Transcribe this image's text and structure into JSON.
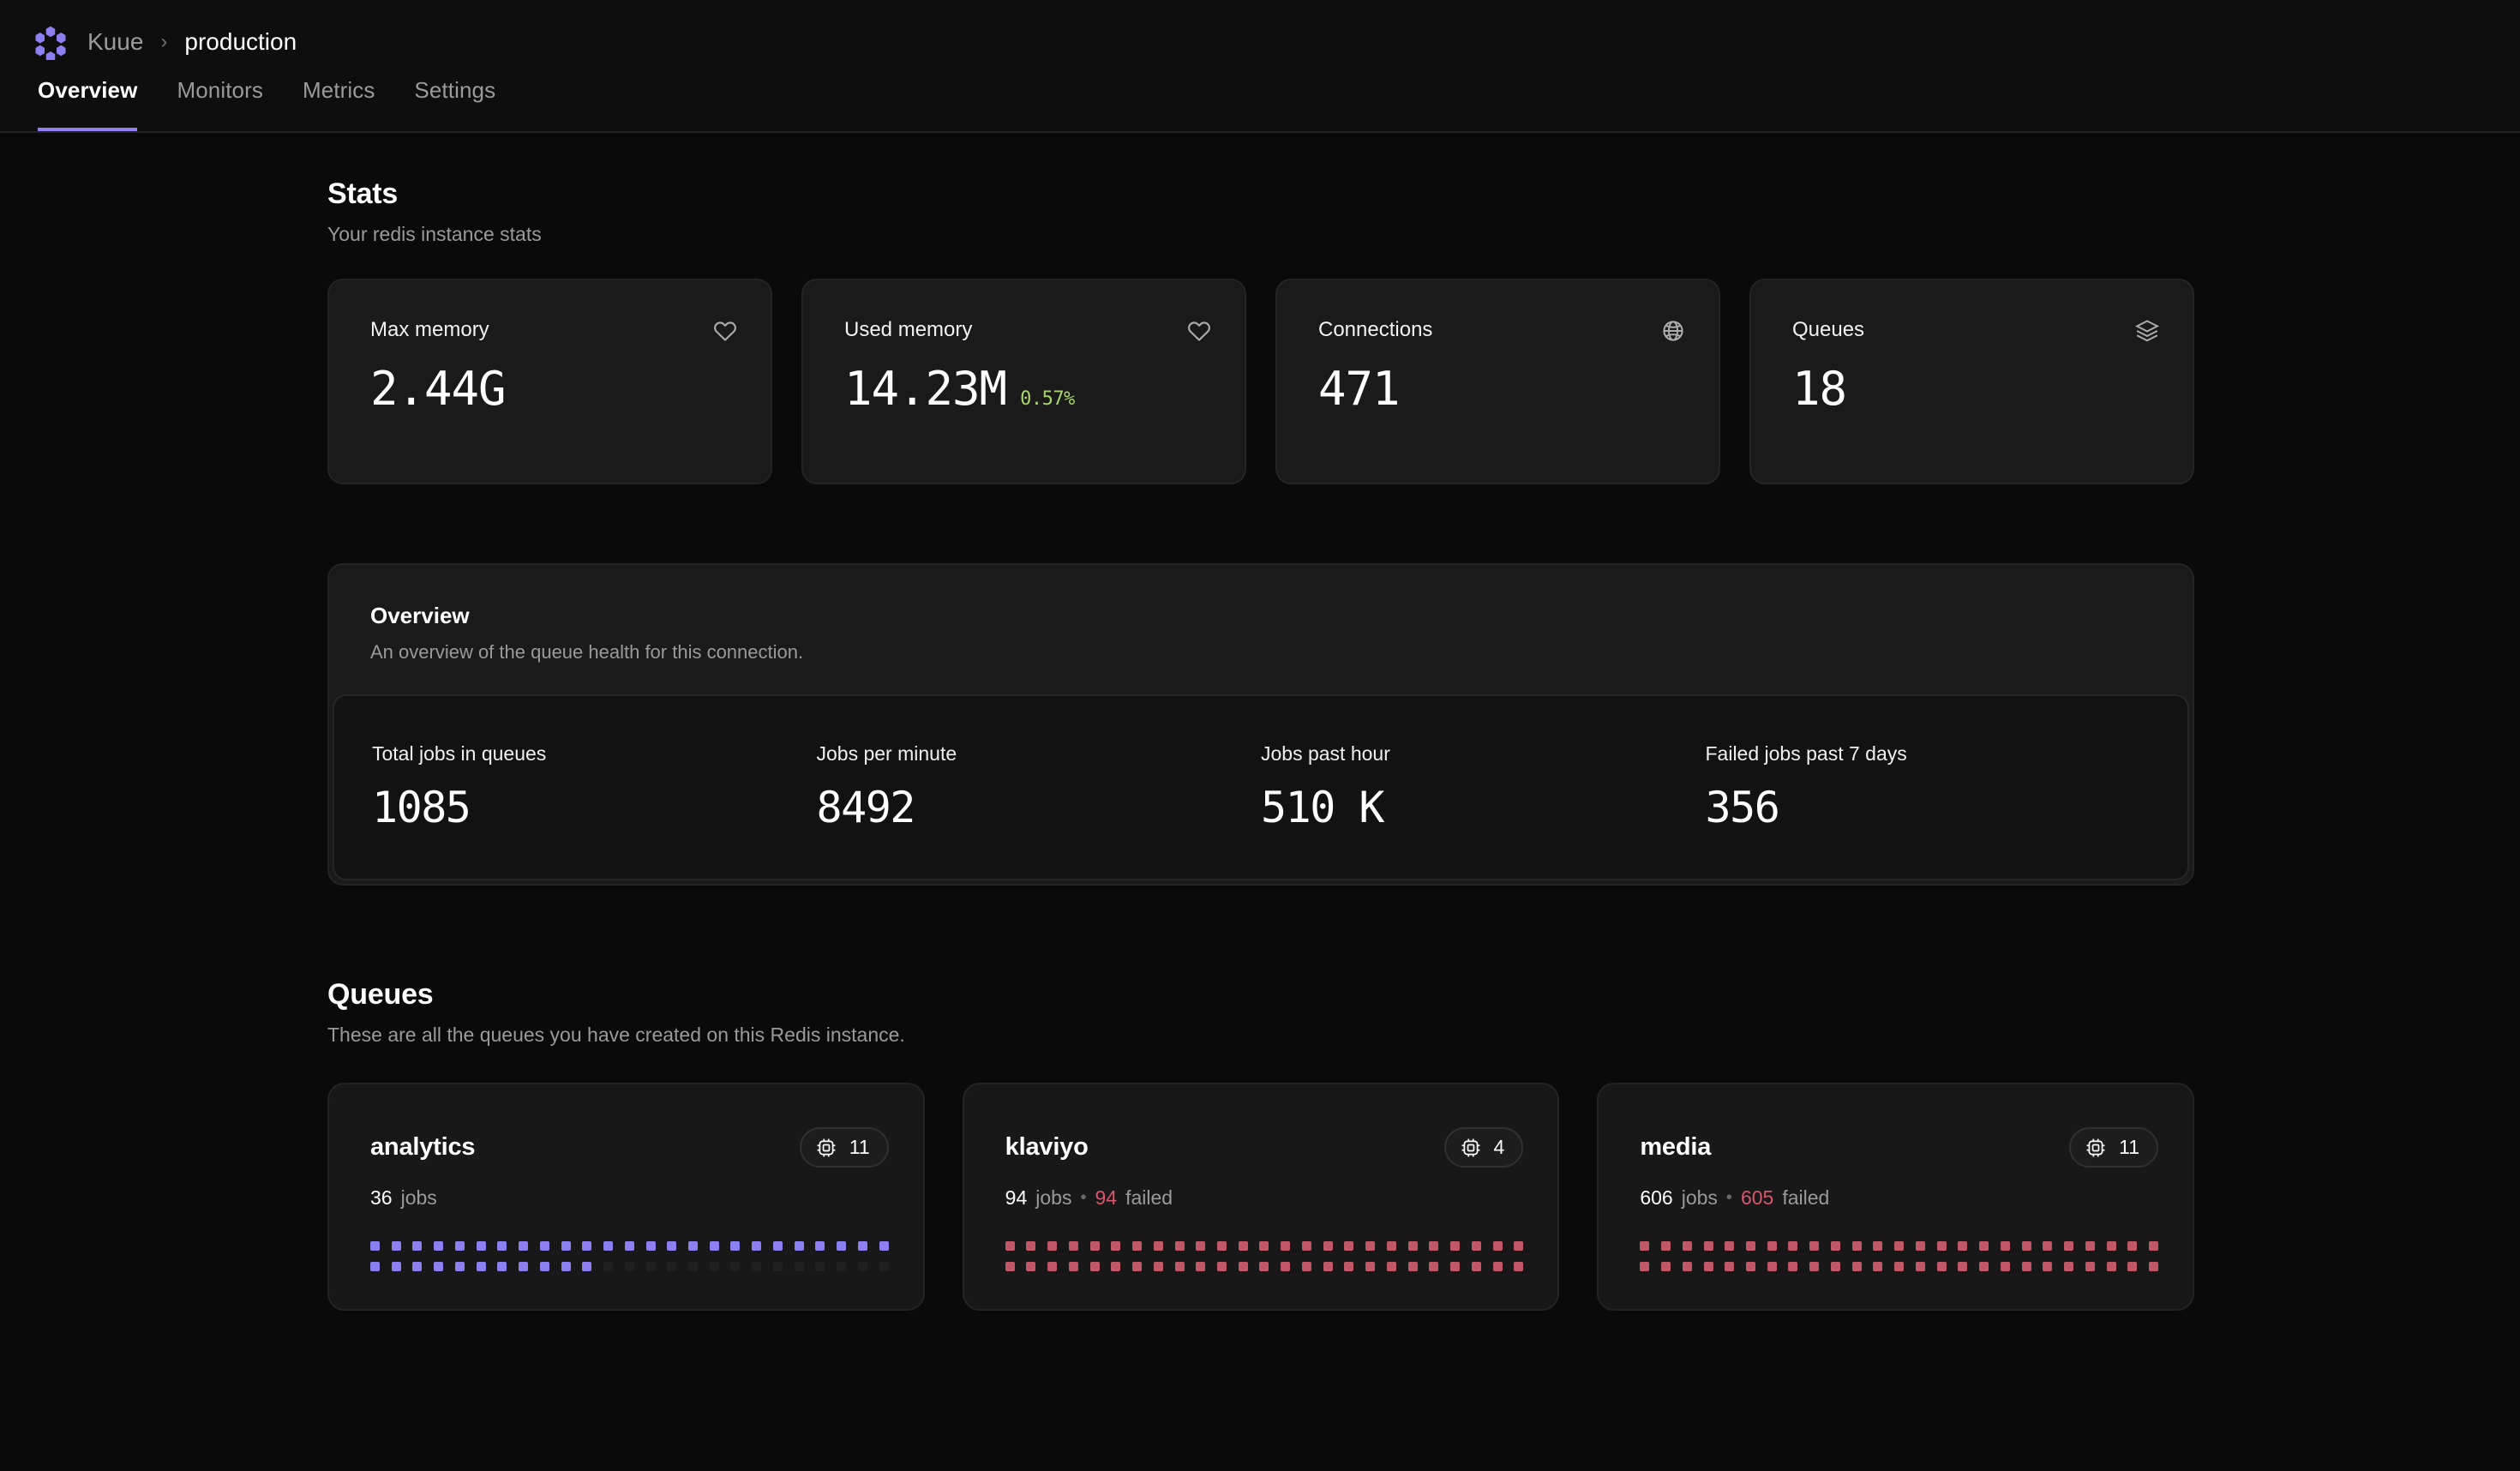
{
  "brand": {
    "logo_icon": "kuue-hexagon-logo",
    "accent_color": "#8b7ff2"
  },
  "breadcrumb": {
    "root": "Kuue",
    "separator": "›",
    "leaf": "production"
  },
  "tabs": [
    {
      "label": "Overview",
      "active": true
    },
    {
      "label": "Monitors",
      "active": false
    },
    {
      "label": "Metrics",
      "active": false
    },
    {
      "label": "Settings",
      "active": false
    }
  ],
  "stats_section": {
    "title": "Stats",
    "subtitle": "Your redis instance stats",
    "cards": [
      {
        "label": "Max memory",
        "value": "2.44G",
        "delta": "",
        "icon": "heart-icon"
      },
      {
        "label": "Used memory",
        "value": "14.23M",
        "delta": "0.57%",
        "icon": "heart-icon",
        "delta_color": "#a9d46a"
      },
      {
        "label": "Connections",
        "value": "471",
        "delta": "",
        "icon": "globe-icon"
      },
      {
        "label": "Queues",
        "value": "18",
        "delta": "",
        "icon": "layers-icon"
      }
    ]
  },
  "overview_panel": {
    "title": "Overview",
    "subtitle": "An overview of the queue health for this connection.",
    "metrics": [
      {
        "label": "Total jobs in queues",
        "value": "1085"
      },
      {
        "label": "Jobs per minute",
        "value": "8492"
      },
      {
        "label": "Jobs past hour",
        "value": "510 K"
      },
      {
        "label": "Failed jobs past 7 days",
        "value": "356"
      }
    ]
  },
  "queues_section": {
    "title": "Queues",
    "subtitle": "These are all the queues you have created on this Redis instance.",
    "queues": [
      {
        "name": "analytics",
        "chip_icon": "cpu-chip-icon",
        "chip_count": "11",
        "jobs_count": "36",
        "jobs_label": "jobs",
        "separator": "•",
        "failed_count": "",
        "failed_label": "",
        "pip_color": "#8b7ff2",
        "pip_empty_color": "#202020",
        "pip_columns": 25,
        "pip_rows": 2,
        "pip_filled": 36
      },
      {
        "name": "klaviyo",
        "chip_icon": "cpu-chip-icon",
        "chip_count": "4",
        "jobs_count": "94",
        "jobs_label": "jobs",
        "separator": "•",
        "failed_count": "94",
        "failed_label": "failed",
        "pip_color": "#c25767",
        "pip_empty_color": "#202020",
        "pip_columns": 25,
        "pip_rows": 2,
        "pip_filled": 50
      },
      {
        "name": "media",
        "chip_icon": "cpu-chip-icon",
        "chip_count": "11",
        "jobs_count": "606",
        "jobs_label": "jobs",
        "separator": "•",
        "failed_count": "605",
        "failed_label": "failed",
        "pip_color": "#c25767",
        "pip_empty_color": "#202020",
        "pip_columns": 25,
        "pip_rows": 2,
        "pip_filled": 50
      }
    ]
  }
}
